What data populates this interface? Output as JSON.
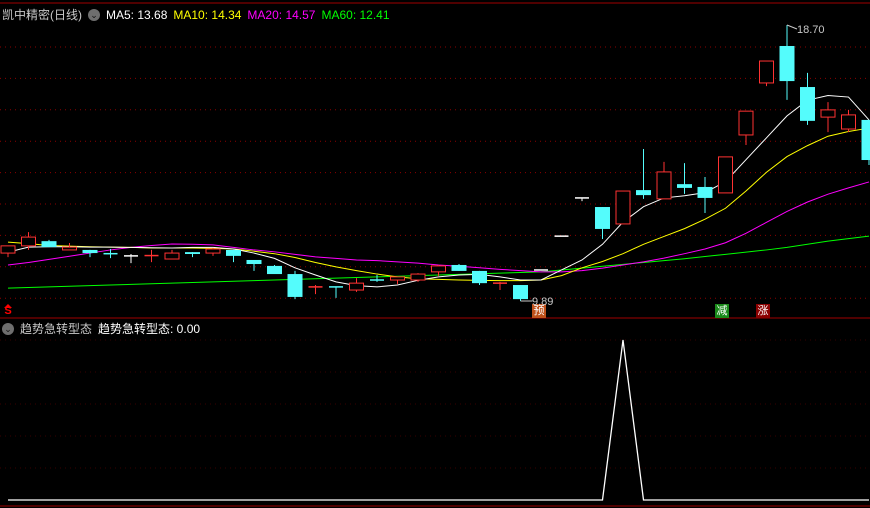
{
  "header": {
    "title": "凯中精密(日线)",
    "ma5": "MA5: 13.68",
    "ma10": "MA10: 14.34",
    "ma20": "MA20: 14.57",
    "ma60": "MA60: 12.41"
  },
  "indicator": {
    "name": "趋势急转型态",
    "value_label": "趋势急转型态: 0.00",
    "values": [
      0,
      0,
      0,
      0,
      0,
      0,
      0,
      0,
      0,
      0,
      0,
      0,
      0,
      0,
      0,
      0,
      0,
      0,
      0,
      0,
      0,
      0,
      0,
      0,
      0,
      0,
      0,
      0,
      0,
      0,
      1,
      0,
      0,
      0,
      0,
      0,
      0,
      0,
      0,
      0,
      0,
      0,
      0
    ]
  },
  "annotations": {
    "high_label": "18.70",
    "low_label": "9.89",
    "signal_s": "S",
    "signal_yu": "预",
    "signal_jian": "减",
    "signal_zhang": "涨"
  },
  "colors": {
    "up": "#ff3232",
    "down": "#54fcfc",
    "flat": "#ffffff",
    "ma5": "#ffffff",
    "ma10": "#ffff00",
    "ma20": "#ff00ff",
    "ma60": "#00ff00",
    "grid": "#8b0000",
    "yu_bg": "#c0501a",
    "jian_bg": "#1a8a1a",
    "zhang_bg": "#8a0000"
  },
  "chart_data": {
    "type": "candlestick",
    "price_range": [
      9.89,
      18.7
    ],
    "candles": [
      [
        11.42,
        11.65,
        11.65,
        11.29
      ],
      [
        11.65,
        11.93,
        12.09,
        11.52
      ],
      [
        11.8,
        11.61,
        11.84,
        11.61
      ],
      [
        11.52,
        11.61,
        11.74,
        11.52
      ],
      [
        11.52,
        11.42,
        11.52,
        11.29
      ],
      [
        11.4,
        11.39,
        11.55,
        11.26
      ],
      [
        11.33,
        11.33,
        11.39,
        11.1
      ],
      [
        11.33,
        11.34,
        11.52,
        11.13
      ],
      [
        11.23,
        11.42,
        11.52,
        11.23
      ],
      [
        11.45,
        11.39,
        11.45,
        11.29
      ],
      [
        11.42,
        11.55,
        11.58,
        11.33
      ],
      [
        11.52,
        11.33,
        11.52,
        11.13
      ],
      [
        11.2,
        11.07,
        11.2,
        10.85
      ],
      [
        11.01,
        10.75,
        11.04,
        10.75
      ],
      [
        10.75,
        10.02,
        10.85,
        9.95
      ],
      [
        10.33,
        10.34,
        10.4,
        10.11
      ],
      [
        10.34,
        10.33,
        10.34,
        9.99
      ],
      [
        10.24,
        10.46,
        10.62,
        10.18
      ],
      [
        10.56,
        10.55,
        10.72,
        10.5
      ],
      [
        10.56,
        10.66,
        10.66,
        10.43
      ],
      [
        10.56,
        10.75,
        10.78,
        10.5
      ],
      [
        10.82,
        11.01,
        11.04,
        10.69
      ],
      [
        11.04,
        10.85,
        11.07,
        10.85
      ],
      [
        10.85,
        10.46,
        10.85,
        10.4
      ],
      [
        10.45,
        10.46,
        10.5,
        10.24
      ],
      [
        10.4,
        9.95,
        10.4,
        9.89
      ],
      [
        10.88,
        10.88,
        10.88,
        10.88
      ],
      [
        11.96,
        11.96,
        11.96,
        11.96
      ],
      [
        13.18,
        13.18,
        13.18,
        13.08
      ],
      [
        12.89,
        12.19,
        12.89,
        11.87
      ],
      [
        12.35,
        13.4,
        13.4,
        12.35
      ],
      [
        13.43,
        13.27,
        14.74,
        13.15
      ],
      [
        13.15,
        14.01,
        14.33,
        13.15
      ],
      [
        13.62,
        13.5,
        14.29,
        13.31
      ],
      [
        13.53,
        13.18,
        13.85,
        12.7
      ],
      [
        13.34,
        14.49,
        14.49,
        13.34
      ],
      [
        15.19,
        15.95,
        15.95,
        14.87
      ],
      [
        16.85,
        17.55,
        17.55,
        16.75
      ],
      [
        18.03,
        16.91,
        18.7,
        16.31
      ],
      [
        16.72,
        15.64,
        17.17,
        15.51
      ],
      [
        15.76,
        15.99,
        16.24,
        15.28
      ],
      [
        15.38,
        15.83,
        15.99,
        15.28
      ],
      [
        15.67,
        14.39,
        15.67,
        14.23
      ]
    ],
    "ma5": [
      11.45,
      11.61,
      11.62,
      11.62,
      11.61,
      11.61,
      11.6,
      11.59,
      11.58,
      11.6,
      11.6,
      11.55,
      11.42,
      11.25,
      10.95,
      10.72,
      10.5,
      10.38,
      10.34,
      10.4,
      10.55,
      10.66,
      10.72,
      10.74,
      10.66,
      10.56,
      10.56,
      10.88,
      11.2,
      11.7,
      12.41,
      12.9,
      13.18,
      13.25,
      13.35,
      13.7,
      14.4,
      15.1,
      15.8,
      16.3,
      16.45,
      16.4,
      15.67
    ],
    "ma10": [
      11.77,
      11.72,
      11.66,
      11.64,
      11.62,
      11.61,
      11.6,
      11.58,
      11.58,
      11.58,
      11.57,
      11.55,
      11.48,
      11.4,
      11.28,
      11.12,
      10.98,
      10.86,
      10.75,
      10.66,
      10.6,
      10.58,
      10.56,
      10.55,
      10.54,
      10.54,
      10.56,
      10.7,
      10.95,
      11.15,
      11.4,
      11.7,
      11.95,
      12.2,
      12.5,
      12.85,
      13.4,
      14.0,
      14.5,
      14.85,
      15.15,
      15.3,
      15.41
    ],
    "ma20": [
      11.04,
      11.12,
      11.22,
      11.32,
      11.42,
      11.52,
      11.6,
      11.66,
      11.71,
      11.7,
      11.68,
      11.6,
      11.52,
      11.46,
      11.38,
      11.3,
      11.25,
      11.2,
      11.18,
      11.14,
      11.1,
      11.04,
      11.0,
      10.95,
      10.9,
      10.86,
      10.82,
      10.82,
      10.86,
      10.94,
      11.04,
      11.14,
      11.26,
      11.4,
      11.55,
      11.75,
      12.05,
      12.4,
      12.75,
      13.05,
      13.3,
      13.5,
      13.69
    ],
    "ma60": [
      10.3,
      10.32,
      10.34,
      10.36,
      10.38,
      10.4,
      10.42,
      10.44,
      10.46,
      10.48,
      10.5,
      10.52,
      10.54,
      10.56,
      10.58,
      10.6,
      10.62,
      10.64,
      10.66,
      10.68,
      10.7,
      10.72,
      10.74,
      10.76,
      10.78,
      10.8,
      10.82,
      10.88,
      10.94,
      11.0,
      11.06,
      11.12,
      11.18,
      11.24,
      11.31,
      11.38,
      11.45,
      11.52,
      11.6,
      11.7,
      11.8,
      11.88,
      11.96
    ],
    "high_index": 38,
    "low_index": 25,
    "signal_indices": {
      "s": 0,
      "yu": 26,
      "jian": 35,
      "zhang": 37
    }
  }
}
